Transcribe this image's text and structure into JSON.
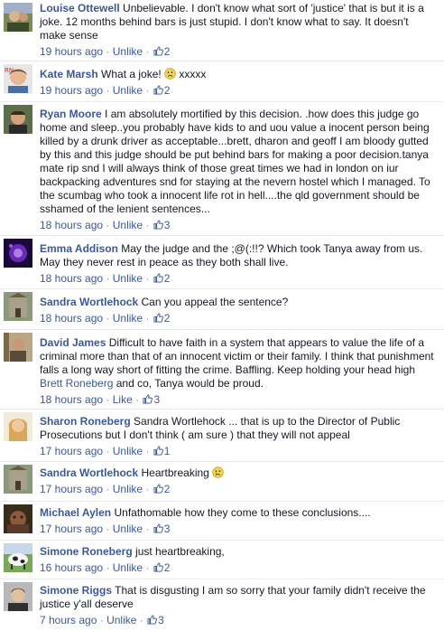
{
  "separator": "·",
  "comments": [
    {
      "author": "Louise Ottewell",
      "text": "Unbelievable. I don't know what sort of 'justice' that is but it is a joke. 12 months behind bars is just stupid. I don't know what to say. It doesn't make sense",
      "time": "19 hours ago",
      "action": "Unlike",
      "likes": "2"
    },
    {
      "author": "Kate Marsh",
      "text": "What a joke!",
      "text_after": "xxxxx",
      "emoji": "frown-emoticon-icon",
      "time": "19 hours ago",
      "action": "Unlike",
      "likes": "2"
    },
    {
      "author": "Ryan Moore",
      "text": "I am absolutely mortified by this decision. .how does this judge go home and sleep..you probably have kids to and uou value a inocent person being killed by a drunk driver as acceptable...brett, dharon and geoff I am bloody gutted by this and this judge should be put behind bars for making a poor decision.tanya mate rip snd I will always think of those great times we had in london on iur backpacking adventures snd for staying at the nevern hostel which I managed. To the scumbag who took a innocent life rot in hell....the qld government should be sshamed of the lenient sentences...",
      "time": "18 hours ago",
      "action": "Unlike",
      "likes": "3"
    },
    {
      "author": "Emma Addison",
      "text": "May the judge and the ;@(:!!? Which took Tanya away from us. May they never rest in peace as they both shall live.",
      "time": "18 hours ago",
      "action": "Unlike",
      "likes": "2"
    },
    {
      "author": "Sandra Wortlehock",
      "text": "Can you appeal the sentence?",
      "time": "18 hours ago",
      "action": "Unlike",
      "likes": "2"
    },
    {
      "author": "David James",
      "text": "Difficult to have faith in a system that appears to value the life of a criminal more than that of an innocent victim or their family. I think that punishment falls a long way short of fitting the crime. Baffling. Keep holding your head high",
      "mention": "Brett Roneberg",
      "text_after": "and co, Tanya would be proud.",
      "time": "18 hours ago",
      "action": "Like",
      "likes": "3"
    },
    {
      "author": "Sharon Roneberg",
      "text": "Sandra Wortlehock ... that is up to the Director of Public Prosecutions but I don't think ( am sure ) that they will not appeal",
      "time": "17 hours ago",
      "action": "Unlike",
      "likes": "1"
    },
    {
      "author": "Sandra Wortlehock",
      "text": "Heartbreaking",
      "emoji": "crying-emoticon-icon",
      "time": "17 hours ago",
      "action": "Unlike",
      "likes": "2"
    },
    {
      "author": "Michael Aylen",
      "text": "Unfathomable how they come to these conclusions....",
      "time": "17 hours ago",
      "action": "Unlike",
      "likes": "3"
    },
    {
      "author": "Simone Roneberg",
      "text": "just heartbreaking,",
      "time": "16 hours ago",
      "action": "Unlike",
      "likes": "2"
    },
    {
      "author": "Simone Riggs",
      "text": "That is disgusting I am so sorry that your family didn't receive the justice y'all deserve",
      "time": "7 hours ago",
      "action": "Unlike",
      "likes": "3"
    }
  ],
  "colors": {
    "link": "#3b5998",
    "meta": "#90949c",
    "text": "#141823",
    "divider": "#e9eaed"
  }
}
